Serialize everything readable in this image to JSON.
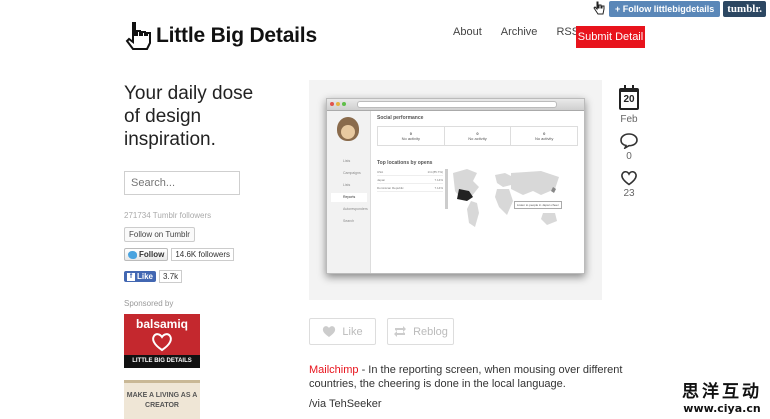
{
  "tumblr_bar": {
    "follow_label": "+ Follow littlebigdetails",
    "logo_text": "tumblr."
  },
  "header": {
    "site_title": "Little Big Details",
    "nav": [
      "About",
      "Archive",
      "RSS"
    ],
    "submit_label": "Submit Detail"
  },
  "sidebar": {
    "tagline": "Your daily dose of design inspiration.",
    "search_placeholder": "Search...",
    "followers_text": "271734 Tumblr followers",
    "follow_tumblr_label": "Follow on Tumblr",
    "twitter_follow_label": "Follow",
    "twitter_followers": "14.6K followers",
    "facebook_like_label": "Like",
    "facebook_count": "3.7k",
    "sponsored_label": "Sponsored by",
    "ad1_brand": "balsamiq",
    "ad1_strip": "LITTLE BIG DETAILS",
    "ad2_text": "MAKE A LIVING AS A CREATOR"
  },
  "post": {
    "screenshot": {
      "section_title": "Social performance",
      "stats": [
        {
          "value": "0",
          "label": "No activity"
        },
        {
          "value": "0",
          "label": "No activity"
        },
        {
          "value": "0",
          "label": "No activity"
        }
      ],
      "locations_title": "Top locations by opens",
      "locations": [
        {
          "country": "USA",
          "value": "1/4 (85.7%)"
        },
        {
          "country": "Japan",
          "value": "7.14%"
        },
        {
          "country": "Dominican Republic",
          "value": "7.14%"
        }
      ],
      "menu": [
        "Lists",
        "Campaigns",
        "Lists",
        "Reports",
        "Autoresponders",
        "Search"
      ],
      "tooltip": "Listen to people in Japan cheer"
    },
    "date_day": "20",
    "date_month": "Feb",
    "comments_count": "0",
    "likes_count": "23",
    "like_label": "Like",
    "reblog_label": "Reblog",
    "caption_link": "Mailchimp",
    "caption_text": " - In the reporting screen, when mousing over different countries, the cheering is done in the local language.",
    "via": "/via TehSeeker"
  },
  "watermark": {
    "cn": "思洋互动",
    "site": "www.ciya.cn"
  },
  "colors": {
    "accent_red": "#e8131c",
    "tumblr_blue": "#5a87b8",
    "twitter_blue": "#4aa3df",
    "facebook_blue": "#4267b2"
  }
}
